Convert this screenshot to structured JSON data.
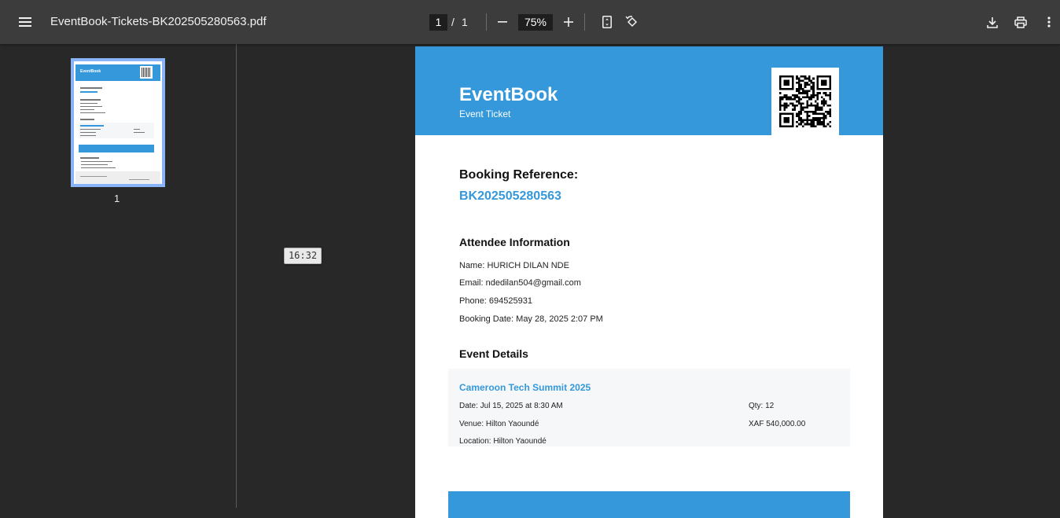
{
  "toolbar": {
    "file_name": "EventBook-Tickets-BK202505280563.pdf",
    "current_page": "1",
    "page_separator": "/",
    "total_pages": "1",
    "zoom": "75%"
  },
  "sidebar": {
    "thumbnails": [
      {
        "label": "1"
      }
    ]
  },
  "overlay": {
    "time_badge": "16:32"
  },
  "ticket": {
    "brand": "EventBook",
    "subtitle": "Event Ticket",
    "booking_label": "Booking Reference:",
    "booking_ref": "BK202505280563",
    "attendee_heading": "Attendee Information",
    "attendee": {
      "name": "Name: HURICH DILAN NDE",
      "email": "Email: ndedilan504@gmail.com",
      "phone": "Phone: 694525931",
      "booking_date": "Booking Date: May 28, 2025 2:07 PM"
    },
    "event_heading": "Event Details",
    "event": {
      "name": "Cameroon Tech Summit 2025",
      "date": "Date: Jul 15, 2025 at 8:30 AM",
      "venue": "Venue: Hilton Yaoundé",
      "location": "Location: Hilton Yaoundé",
      "qty": "Qty: 12",
      "price": "XAF 540,000.00"
    }
  },
  "colors": {
    "accent": "#3498db",
    "toolbar_bg": "#3c3c3c",
    "viewer_bg": "#282828"
  }
}
